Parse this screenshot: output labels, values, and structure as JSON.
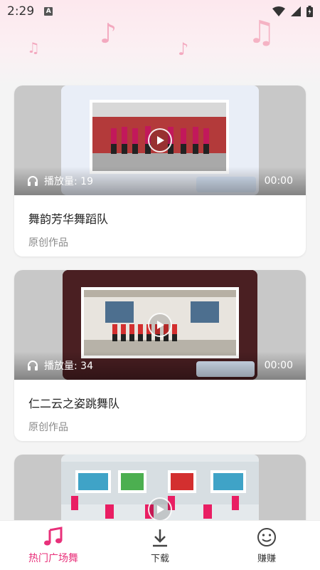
{
  "status_bar": {
    "time": "2:29",
    "a_badge": "A",
    "wifi_icon": "wifi-icon",
    "signal_icon": "signal-icon",
    "battery_icon": "battery-icon"
  },
  "feed": [
    {
      "plays_label": "播放量: 19",
      "duration": "00:00",
      "title": "舞韵芳华舞蹈队",
      "subtitle": "原创作品"
    },
    {
      "plays_label": "播放量: 34",
      "duration": "00:00",
      "title": "仁二云之姿跳舞队",
      "subtitle": "原创作品"
    },
    {
      "plays_label": "",
      "duration": "",
      "title": "",
      "subtitle": ""
    }
  ],
  "bottom_nav": {
    "items": [
      {
        "label": "热门广场舞",
        "icon": "music-note-icon",
        "active": true
      },
      {
        "label": "下载",
        "icon": "download-icon",
        "active": false
      },
      {
        "label": "赚赚",
        "icon": "smiley-icon",
        "active": false
      }
    ]
  },
  "colors": {
    "accent": "#e8307a",
    "header_tint": "#fde8ee"
  }
}
